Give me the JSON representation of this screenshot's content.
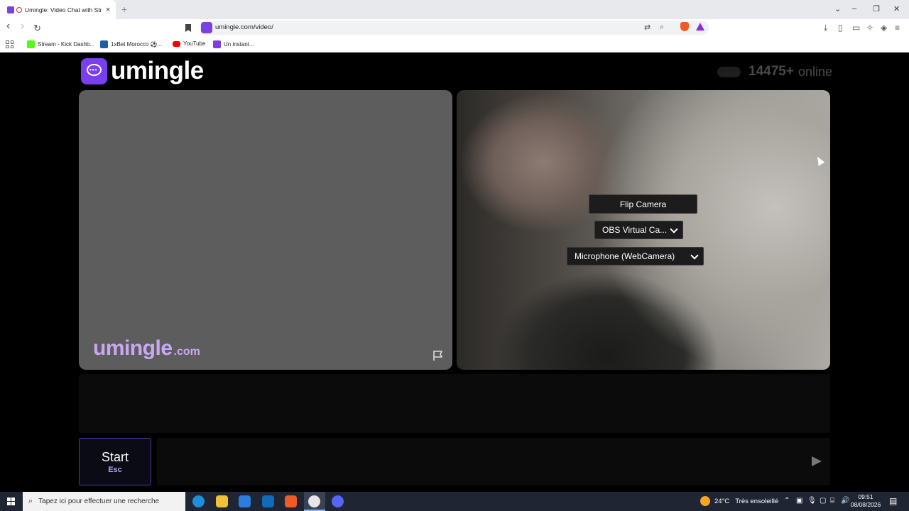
{
  "browser": {
    "tab_title": "Umingle: Video Chat with Str",
    "tab_close": "×",
    "new_tab": "+",
    "url": "umingle.com/video/",
    "window_controls": {
      "dropdown": "⌄",
      "minimize": "–",
      "maximize": "❐",
      "close": "✕"
    },
    "nav": {
      "back": "‹",
      "forward": "›",
      "reload": "↻"
    },
    "bookmarks": [
      {
        "label": "Stream - Kick Dashb...",
        "icon": "kick-icon",
        "color": "#53fc18"
      },
      {
        "label": "1xBet Morocco ⚽...",
        "icon": "1xbet-icon",
        "color": "#1b5fa8"
      },
      {
        "label": "YouTube",
        "icon": "youtube-icon",
        "color": "#ff0000"
      },
      {
        "label": "Un instant...",
        "icon": "umingle-icon",
        "color": "#7b3fe4"
      }
    ]
  },
  "app": {
    "logo_text": "umingle",
    "online_count": "14475+",
    "online_label": "online",
    "watermark_main": "umingle",
    "watermark_suffix": ".com",
    "flip_camera": "Flip Camera",
    "camera_select": "OBS Virtual Ca...",
    "microphone_select": "Microphone (WebCamera)",
    "start_label": "Start",
    "start_key": "Esc",
    "message_placeholder": "",
    "brand_color": "#7a3ff0"
  },
  "taskbar": {
    "search_placeholder": "Tapez ici pour effectuer une recherche",
    "weather_temp": "24°C",
    "weather_text": "Très ensoleillé",
    "time": "09:51",
    "date": "08/08/2026"
  }
}
